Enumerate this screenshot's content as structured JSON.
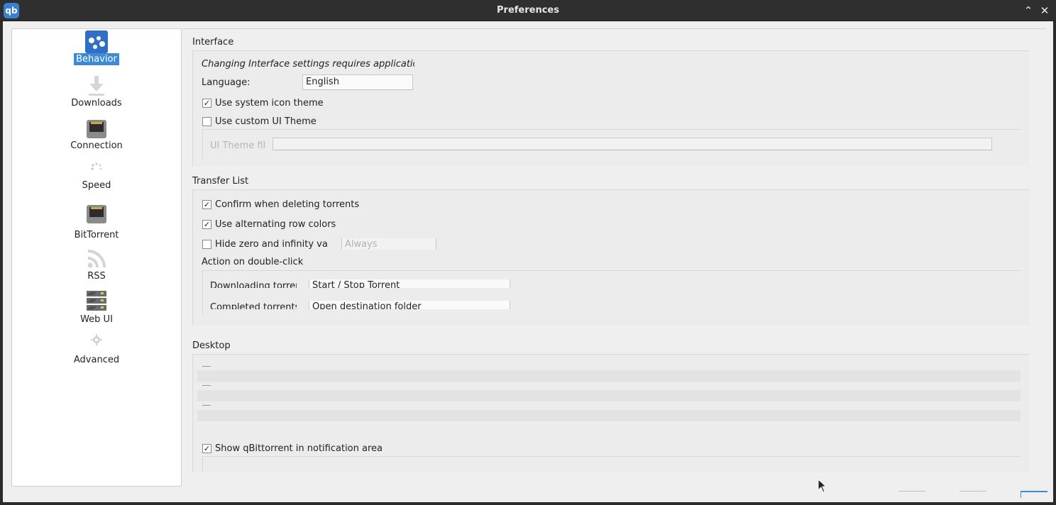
{
  "window": {
    "title": "Preferences",
    "app_icon": "qb"
  },
  "titlebar_controls": {
    "maximize_icon": "chevron-up-icon",
    "close_icon": "close-icon",
    "maximize_glyph": "⌃",
    "close_glyph": "✕"
  },
  "sidebar": {
    "items": [
      {
        "label": "Behavior",
        "icon": "behavior-icon",
        "active": true
      },
      {
        "label": "Downloads",
        "icon": "download-icon"
      },
      {
        "label": "Connection",
        "icon": "connection-icon"
      },
      {
        "label": "Speed",
        "icon": "speed-icon"
      },
      {
        "label": "BitTorrent",
        "icon": "bittorrent-icon"
      },
      {
        "label": "RSS",
        "icon": "rss-icon"
      },
      {
        "label": "Web UI",
        "icon": "webui-icon"
      },
      {
        "label": "Advanced",
        "icon": "gear-icon"
      }
    ]
  },
  "interface": {
    "title": "Interface",
    "note": "Changing Interface settings requires application rest",
    "language_label": "Language:",
    "language_value": "English",
    "use_system_icon_theme": "Use system icon theme",
    "use_system_icon_theme_checked": "✓",
    "use_custom_ui_theme": "Use custom UI Theme",
    "ui_theme_file_label": "UI Theme fil",
    "ui_theme_file_value": ""
  },
  "transfer_list": {
    "title": "Transfer List",
    "confirm_delete": "Confirm when deleting torrents",
    "confirm_delete_checked": "✓",
    "alt_row_colors": "Use alternating row colors",
    "alt_row_colors_checked": "✓",
    "hide_zero": "Hide zero and infinity valu",
    "hide_zero_value": "Always",
    "double_click_title": "Action on double-click",
    "downloading_label": "Downloading torren",
    "downloading_value": "Start / Stop Torrent",
    "completed_label": "Completed torrents:",
    "completed_value": "Open destination folder"
  },
  "desktop": {
    "title": "Desktop",
    "show_notification_area": "Show qBittorrent in notification area",
    "show_notification_area_checked": "✓"
  }
}
